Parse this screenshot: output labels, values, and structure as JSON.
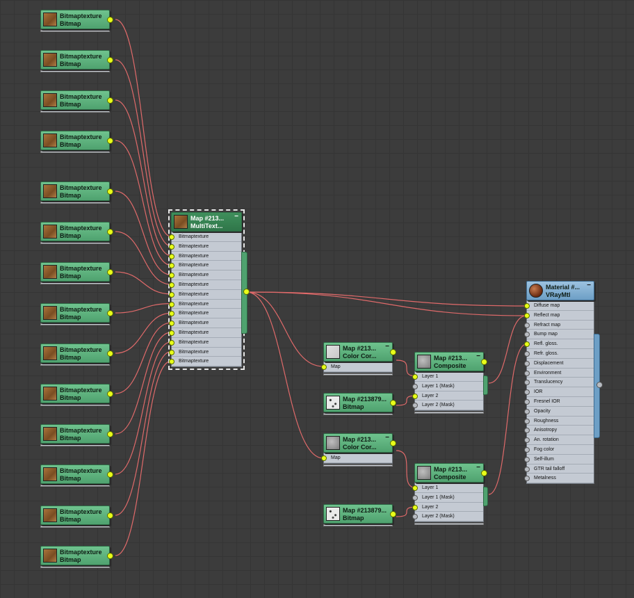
{
  "bitmap_nodes": [
    {
      "title": "Bitmaptexture",
      "subtitle": "Bitmap"
    },
    {
      "title": "Bitmaptexture",
      "subtitle": "Bitmap"
    },
    {
      "title": "Bitmaptexture",
      "subtitle": "Bitmap"
    },
    {
      "title": "Bitmaptexture",
      "subtitle": "Bitmap"
    },
    {
      "title": "Bitmaptexture",
      "subtitle": "Bitmap"
    },
    {
      "title": "Bitmaptexture",
      "subtitle": "Bitmap"
    },
    {
      "title": "Bitmaptexture",
      "subtitle": "Bitmap"
    },
    {
      "title": "Bitmaptexture",
      "subtitle": "Bitmap"
    },
    {
      "title": "Bitmaptexture",
      "subtitle": "Bitmap"
    },
    {
      "title": "Bitmaptexture",
      "subtitle": "Bitmap"
    },
    {
      "title": "Bitmaptexture",
      "subtitle": "Bitmap"
    },
    {
      "title": "Bitmaptexture",
      "subtitle": "Bitmap"
    },
    {
      "title": "Bitmaptexture",
      "subtitle": "Bitmap"
    },
    {
      "title": "Bitmaptexture",
      "subtitle": "Bitmap"
    }
  ],
  "multitex_node": {
    "title": "Map #213...",
    "subtitle": "MultiText...",
    "minimize": "−",
    "slots": [
      "Bitmaptexture",
      "Bitmaptexture",
      "Bitmaptexture",
      "Bitmaptexture",
      "Bitmaptexture",
      "Bitmaptexture",
      "Bitmaptexture",
      "Bitmaptexture",
      "Bitmaptexture",
      "Bitmaptexture",
      "Bitmaptexture",
      "Bitmaptexture",
      "Bitmaptexture",
      "Bitmaptexture"
    ]
  },
  "color_correct_nodes": [
    {
      "title": "Map #213...",
      "subtitle": "Color Cor...",
      "minimize": "−",
      "slot": "Map"
    },
    {
      "title": "Map #213...",
      "subtitle": "Color Cor...",
      "minimize": "−",
      "slot": "Map"
    }
  ],
  "small_bitmap_nodes": [
    {
      "title": "Map #213879...",
      "subtitle": "Bitmap"
    },
    {
      "title": "Map #213879...",
      "subtitle": "Bitmap"
    }
  ],
  "composite_nodes": [
    {
      "title": "Map #213...",
      "subtitle": "Composite",
      "minimize": "−",
      "slots": [
        "Layer 1",
        "Layer 1 (Mask)",
        "Layer 2",
        "Layer 2 (Mask)"
      ]
    },
    {
      "title": "Map #213...",
      "subtitle": "Composite",
      "minimize": "−",
      "slots": [
        "Layer 1",
        "Layer 1 (Mask)",
        "Layer 2",
        "Layer 2 (Mask)"
      ]
    }
  ],
  "material_node": {
    "title": "Material #...",
    "subtitle": "VRayMtl",
    "minimize": "−",
    "slots": [
      "Diffuse map",
      "Reflect map",
      "Refract map",
      "Bump map",
      "Refl. gloss.",
      "Refr. gloss.",
      "Displacement",
      "Environment",
      "Translucency",
      "IOR",
      "Fresnel IOR",
      "Opacity",
      "Roughness",
      "Anisotropy",
      "An. rotation",
      "Fog color",
      "Self-illum",
      "GTR tail falloff",
      "Metalness"
    ]
  },
  "colors": {
    "wire": "#e06a6a",
    "socket_active": "#e8ff1a",
    "node_green": "#5fb07e",
    "node_blue": "#7fb0d6"
  }
}
